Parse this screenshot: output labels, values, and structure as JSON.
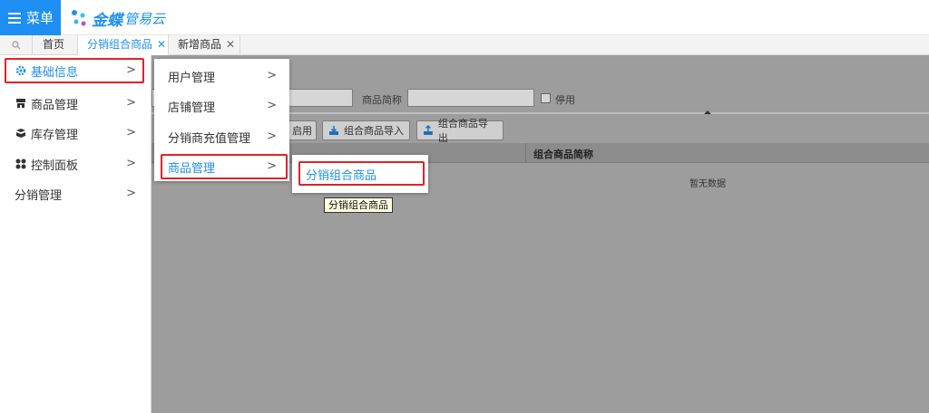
{
  "header": {
    "menu_label": "菜单",
    "logo_main": "金蝶",
    "logo_sub": "管易云"
  },
  "tabs": [
    {
      "label": "首页",
      "closable": false
    },
    {
      "label": "分销组合商品",
      "closable": true,
      "active": true
    },
    {
      "label": "新增商品",
      "closable": true
    }
  ],
  "tab_close": "✕",
  "chev": ">",
  "sidebar": {
    "items": [
      {
        "label": "基础信息",
        "icon": "gear-icon",
        "active": true
      },
      {
        "label": "商品管理",
        "icon": "shop-icon"
      },
      {
        "label": "库存管理",
        "icon": "inventory-icon"
      },
      {
        "label": "控制面板",
        "icon": "dashboard-icon"
      },
      {
        "label": "分销管理",
        "icon": ""
      }
    ]
  },
  "flyout1": {
    "items": [
      {
        "label": "用户管理"
      },
      {
        "label": "店铺管理"
      },
      {
        "label": "分销商充值管理"
      },
      {
        "label": "商品管理",
        "active": true
      }
    ]
  },
  "flyout2": {
    "items": [
      {
        "label": "分销组合商品",
        "active": true
      }
    ]
  },
  "tooltip": "分销组合商品",
  "content": {
    "filter_label": "商品简称",
    "checkbox_label": "停用",
    "buttons": {
      "enable": "启用",
      "import": "组合商品导入",
      "export": "组合商品导出"
    },
    "table_header": "组合商品简称",
    "empty_text": "暂无数据"
  },
  "colors": {
    "accent": "#1e8ff2",
    "highlight": "#e1212b",
    "overlay": "#9d9d9d"
  }
}
